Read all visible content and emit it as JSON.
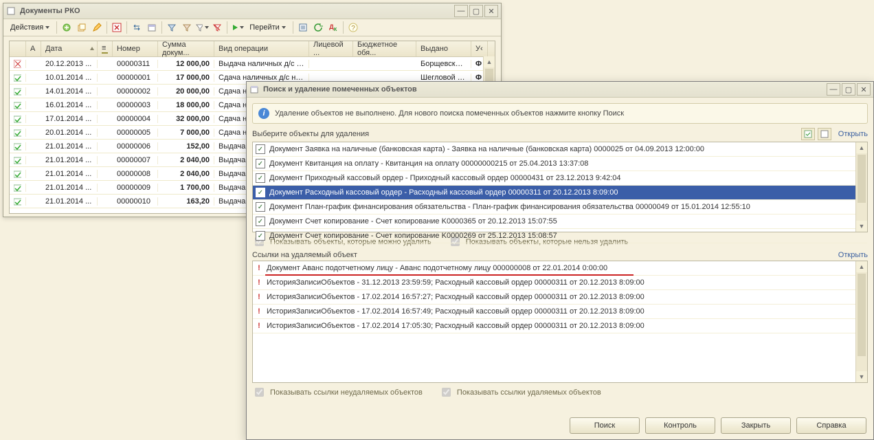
{
  "main_window": {
    "title": "Документы РКО",
    "actions_label": "Действия",
    "goto_label": "Перейти"
  },
  "grid": {
    "columns": {
      "status": "",
      "a": "А",
      "date": "Дата",
      "sort": "",
      "number": "Номер",
      "sum": "Сумма докум...",
      "op": "Вид операции",
      "account": "Лицевой ...",
      "budget": "Бюджетное обя...",
      "issued": "Выдано",
      "flag": "У‹"
    },
    "rows": [
      {
        "status": "x",
        "date": "20.12.2013 ...",
        "number": "00000311",
        "sum": "12 000,00",
        "op": "Выдача наличных д/с п...",
        "issued": "Борщевской ...",
        "flag": "Φ"
      },
      {
        "status": "ok",
        "date": "10.01.2014 ...",
        "number": "00000001",
        "sum": "17 000,00",
        "op": "Сдача наличных д/с на ...",
        "issued": "Шегловой Лю",
        "flag": "Φ"
      },
      {
        "status": "ok",
        "date": "14.01.2014 ...",
        "number": "00000002",
        "sum": "20 000,00",
        "op": "Сдача нал..",
        "issued": "",
        "flag": ""
      },
      {
        "status": "ok",
        "date": "16.01.2014 ...",
        "number": "00000003",
        "sum": "18 000,00",
        "op": "Сдача нал..",
        "issued": "",
        "flag": ""
      },
      {
        "status": "ok",
        "date": "17.01.2014 ...",
        "number": "00000004",
        "sum": "32 000,00",
        "op": "Сдача нал..",
        "issued": "",
        "flag": ""
      },
      {
        "status": "ok",
        "date": "20.01.2014 ...",
        "number": "00000005",
        "sum": "7 000,00",
        "op": "Сдача нал..",
        "issued": "",
        "flag": ""
      },
      {
        "status": "ok",
        "date": "21.01.2014 ...",
        "number": "00000006",
        "sum": "152,00",
        "op": "Выдача на..",
        "issued": "",
        "flag": ""
      },
      {
        "status": "ok",
        "date": "21.01.2014 ...",
        "number": "00000007",
        "sum": "2 040,00",
        "op": "Выдача на..",
        "issued": "",
        "flag": ""
      },
      {
        "status": "ok",
        "date": "21.01.2014 ...",
        "number": "00000008",
        "sum": "2 040,00",
        "op": "Выдача на..",
        "issued": "",
        "flag": ""
      },
      {
        "status": "ok",
        "date": "21.01.2014 ...",
        "number": "00000009",
        "sum": "1 700,00",
        "op": "Выдача на..",
        "issued": "",
        "flag": ""
      },
      {
        "status": "ok",
        "date": "21.01.2014 ...",
        "number": "00000010",
        "sum": "163,20",
        "op": "Выдача на..",
        "issued": "",
        "flag": ""
      }
    ]
  },
  "modal": {
    "title": "Поиск и удаление помеченных объектов",
    "info": "Удаление объектов не выполнено. Для нового поиска помеченных объектов нажмите кнопку Поиск",
    "choose_label": "Выберите объекты для удаления",
    "open_label": "Открыть",
    "items": [
      "Документ Заявка на наличные (банковская карта) - Заявка на наличные (банковская карта) 0000025 от 04.09.2013 12:00:00",
      "Документ Квитанция на оплату - Квитанция на оплату 00000000215 от 25.04.2013 13:37:08",
      "Документ Приходный кассовый ордер - Приходный кассовый ордер 00000431 от 23.12.2013 9:42:04",
      "Документ Расходный кассовый ордер - Расходный кассовый ордер 00000311 от 20.12.2013 8:09:00",
      "Документ План-график финансирования обязательства - План-график финансирования обязательства 00000049 от 15.01.2014 12:55:10",
      "Документ Счет копирование - Счет копирование K0000365 от 20.12.2013 15:07:55",
      "Документ Счет копирование - Счет копирование K0000269 от 25.12.2013 15:08:57"
    ],
    "cb_can_delete": "Показывать объекты, которые можно удалить",
    "cb_cannot_delete": "Показывать объекты, которые нельзя удалить",
    "refs_label": "Ссылки на удаляемый объект",
    "refs": [
      "Документ Аванс подотчетному лицу - Аванс подотчетному лицу 000000008 от 22.01.2014 0:00:00",
      "ИсторияЗаписиОбъектов - 31.12.2013 23:59:59; Расходный кассовый ордер 00000311 от 20.12.2013 8:09:00",
      "ИсторияЗаписиОбъектов - 17.02.2014 16:57:27; Расходный кассовый ордер 00000311 от 20.12.2013 8:09:00",
      "ИсторияЗаписиОбъектов - 17.02.2014 16:57:49; Расходный кассовый ордер 00000311 от 20.12.2013 8:09:00",
      "ИсторияЗаписиОбъектов - 17.02.2014 17:05:30; Расходный кассовый ордер 00000311 от 20.12.2013 8:09:00"
    ],
    "cb_refs_nondeletable": "Показывать ссылки неудаляемых объектов",
    "cb_refs_deletable": "Показывать ссылки удаляемых объектов",
    "btn_search": "Поиск",
    "btn_control": "Контроль",
    "btn_close": "Закрыть",
    "btn_help": "Справка"
  }
}
